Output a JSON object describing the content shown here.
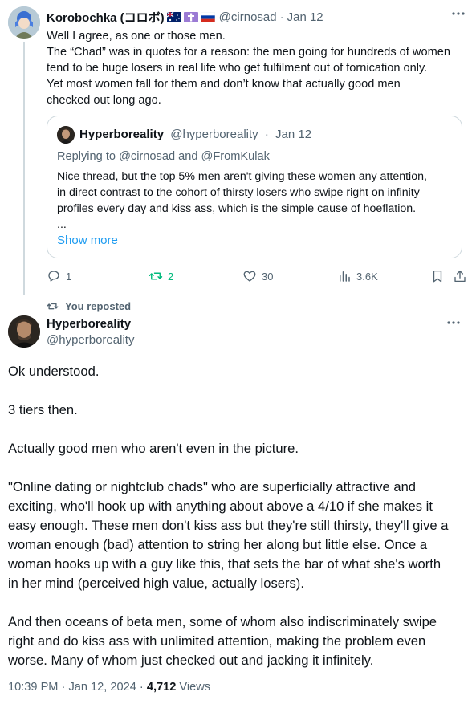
{
  "reply_tweet": {
    "author_name": "Korobochka (コロボ)",
    "flags": [
      "australia-flag",
      "cross-flag",
      "russia-flag"
    ],
    "handle": "@cirnosad",
    "separator": "·",
    "date": "Jan 12",
    "more_icon": "more-horizontal-icon",
    "lines": [
      "Well I agree, as one or those men.",
      "The “Chad” was in quotes for a reason: the men going for hundreds of women",
      "tend to be huge losers in real life who get fulfilment out of fornication only.",
      "Yet most women fall for them and don’t know that actually good men",
      "checked out long ago."
    ],
    "quote": {
      "author_name": "Hyperboreality",
      "handle": "@hyperboreality",
      "separator": "·",
      "date": "Jan 12",
      "replying_prefix": "Replying to ",
      "replying_user1": "@cirnosad",
      "replying_and": " and ",
      "replying_user2": "@FromKulak",
      "lines": [
        "Nice thread, but the top 5% men aren't giving these women any attention,",
        "in direct contrast to the cohort of thirsty losers who swipe right on infinity",
        "profiles every day and kiss ass, which is the simple cause of hoeflation.",
        "..."
      ],
      "show_more": "Show more"
    },
    "actions": {
      "replies": "1",
      "reposts": "2",
      "likes": "30",
      "views": "3.6K"
    }
  },
  "repost_label": "You reposted",
  "main_tweet": {
    "author_name": "Hyperboreality",
    "handle": "@hyperboreality",
    "more_icon": "more-horizontal-icon",
    "paragraphs": [
      [
        "Ok understood."
      ],
      [
        "3 tiers then."
      ],
      [
        "Actually good men who aren't even in the picture."
      ],
      [
        "\"Online dating or nightclub chads\" who are superficially attractive and",
        "exciting, who'll hook up with anything about above a 4/10 if she makes it",
        "easy enough. These men don't kiss ass but they're still thirsty, they'll give a",
        "woman enough (bad) attention to string her along but little else. Once a",
        "woman hooks up with a guy like this, that sets the bar of what she's worth",
        "in her mind (perceived high value, actually losers)."
      ],
      [
        "And then oceans of beta men, some of whom also indiscriminately swipe",
        "right and do kiss ass with unlimited attention, making the problem even",
        "worse. Many of whom just checked out and jacking it infinitely."
      ]
    ],
    "time": "10:39 PM",
    "separator": " · ",
    "date": "Jan 12, 2024",
    "separator2": " · ",
    "views_count": "4,712",
    "views_label": " Views"
  },
  "colors": {
    "text": "#0f1419",
    "muted": "#536471",
    "link": "#1d9bf0",
    "repost_green": "#00ba7c",
    "border": "#cfd9de"
  }
}
